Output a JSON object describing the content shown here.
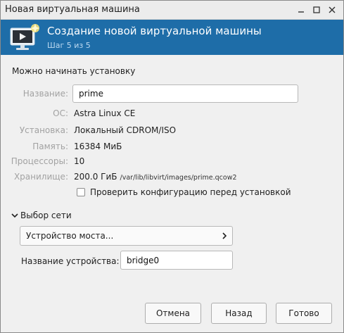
{
  "window": {
    "title": "Новая виртуальная машина"
  },
  "banner": {
    "title": "Создание новой виртуальной машины",
    "step": "Шаг 5 из 5",
    "background": "#1e6da8"
  },
  "ready_label": "Можно начинать установку",
  "fields": {
    "name": {
      "label": "Название:",
      "value": "prime"
    },
    "os": {
      "label": "ОС:",
      "value": "Astra Linux CE"
    },
    "install": {
      "label": "Установка:",
      "value": "Локальный CDROM/ISO"
    },
    "memory": {
      "label": "Память:",
      "value": "16384 МиБ"
    },
    "cpus": {
      "label": "Процессоры:",
      "value": "10"
    },
    "storage": {
      "label": "Хранилище:",
      "value": "200.0 ГиБ",
      "path": "/var/lib/libvirt/images/prime.qcow2"
    }
  },
  "customize": {
    "label": "Проверить конфигурацию перед установкой",
    "checked": false
  },
  "network": {
    "section_label": "Выбор сети",
    "expanded": true,
    "selection": "Устройство моста...",
    "device_label": "Название устройства:",
    "device_value": "bridge0"
  },
  "buttons": {
    "cancel": "Отмена",
    "back": "Назад",
    "finish": "Готово"
  }
}
